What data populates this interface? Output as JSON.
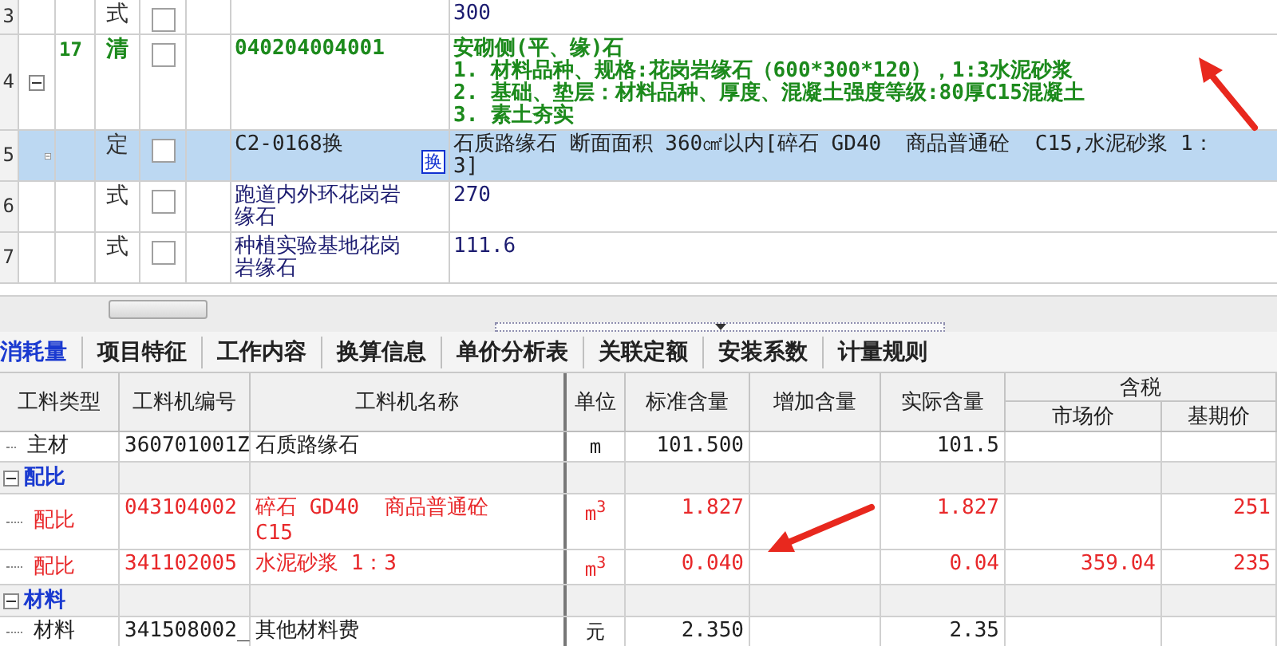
{
  "grid": {
    "rows": [
      {
        "number": "3",
        "kind": "formula",
        "type": "式",
        "checked": false,
        "selected": false,
        "value": "300"
      },
      {
        "number": "4",
        "kind": "bill",
        "level": "17",
        "type": "清",
        "checked": false,
        "selected": false,
        "expanded": true,
        "code": "040204004001",
        "name_lines": [
          "安砌侧(平、缘)石",
          "1. 材料品种、规格:花岗岩缘石（600*300*120），1:3水泥砂浆",
          "2. 基础、垫层：材料品种、厚度、混凝土强度等级:80厚C15混凝土",
          "3. 素土夯实"
        ]
      },
      {
        "number": "5",
        "kind": "quota",
        "type": "定",
        "checked": false,
        "selected": true,
        "expanded": true,
        "code": "C2-0168换",
        "badge": "换",
        "name_lines": [
          "石质路缘石 断面面积 360㎠以内[碎石 GD40  商品普通砼  C15,水泥砂浆 1：",
          "3]"
        ]
      },
      {
        "number": "6",
        "kind": "formula",
        "type": "式",
        "checked": false,
        "selected": false,
        "code": "跑道内外环花岗岩缘石",
        "value": "270"
      },
      {
        "number": "7",
        "kind": "formula",
        "type": "式",
        "checked": false,
        "selected": false,
        "code": "种植实验基地花岗岩缘石",
        "value": "111.6"
      }
    ]
  },
  "tabs": [
    {
      "label": "消耗量",
      "selected": true
    },
    {
      "label": "项目特征",
      "selected": false
    },
    {
      "label": "工作内容",
      "selected": false
    },
    {
      "label": "换算信息",
      "selected": false
    },
    {
      "label": "单价分析表",
      "selected": false
    },
    {
      "label": "关联定额",
      "selected": false
    },
    {
      "label": "安装系数",
      "selected": false
    },
    {
      "label": "计量规则",
      "selected": false
    }
  ],
  "materials": {
    "columns": [
      "工料类型",
      "工料机编号",
      "工料机名称",
      "单位",
      "标准含量",
      "增加含量",
      "实际含量"
    ],
    "tax_group": "含税",
    "tax_columns": [
      "市场价",
      "基期价"
    ],
    "rows": [
      {
        "kind": "item",
        "type": "主材",
        "code": "360701001Z",
        "name": "石质路缘石",
        "unit": "m",
        "standard": "101.500",
        "actual": "101.5",
        "color": "#202020"
      },
      {
        "kind": "group",
        "label": "配比",
        "expanded": true,
        "children": [
          {
            "kind": "item",
            "type": "配比",
            "code": "043104002",
            "name": "碎石 GD40  商品普通砼 C15",
            "unit": "m$^{3}$",
            "standard": "1.827",
            "actual": "1.827",
            "base_price": "251",
            "color": "#e8282a"
          },
          {
            "kind": "item",
            "type": "配比",
            "code": "341102005",
            "name": "水泥砂浆 1：3",
            "unit": "m$^{3}$",
            "standard": "0.040",
            "actual": "0.04",
            "market_price": "359.04",
            "base_price": "235",
            "color": "#e8282a"
          }
        ]
      },
      {
        "kind": "group",
        "label": "材料",
        "expanded": true,
        "children": [
          {
            "kind": "item",
            "type": "材料",
            "code": "341508002_",
            "name": "其他材料费",
            "unit": "元",
            "standard": "2.350",
            "actual": "2.35",
            "color": "#202020"
          }
        ]
      }
    ]
  }
}
